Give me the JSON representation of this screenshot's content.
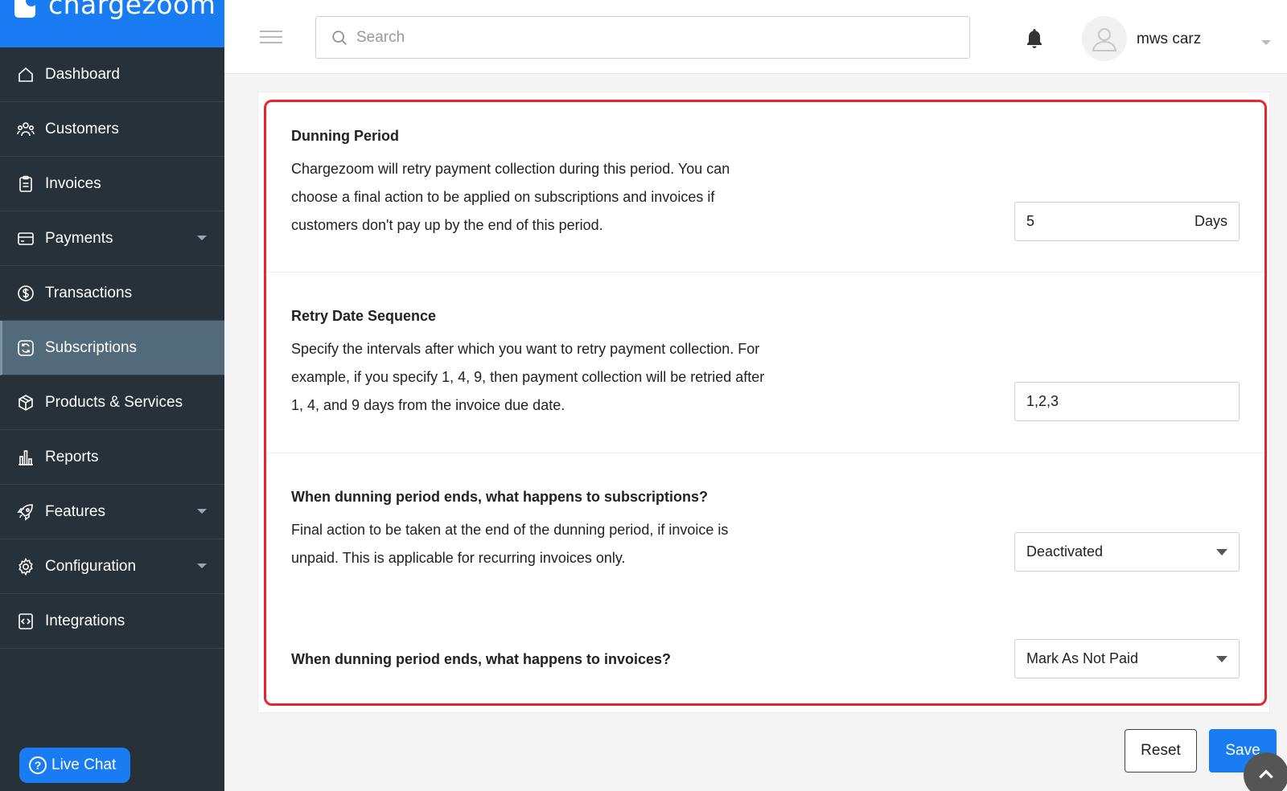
{
  "brand": {
    "name": "chargezoom"
  },
  "sidebar": {
    "items": [
      {
        "label": "Dashboard",
        "icon": "home-icon",
        "has_submenu": false,
        "active": false
      },
      {
        "label": "Customers",
        "icon": "users-icon",
        "has_submenu": false,
        "active": false
      },
      {
        "label": "Invoices",
        "icon": "clipboard-icon",
        "has_submenu": false,
        "active": false
      },
      {
        "label": "Payments",
        "icon": "card-icon",
        "has_submenu": true,
        "active": false
      },
      {
        "label": "Transactions",
        "icon": "dollar-icon",
        "has_submenu": false,
        "active": false
      },
      {
        "label": "Subscriptions",
        "icon": "refresh-icon",
        "has_submenu": false,
        "active": true
      },
      {
        "label": "Products & Services",
        "icon": "box-icon",
        "has_submenu": false,
        "active": false
      },
      {
        "label": "Reports",
        "icon": "bar-chart-icon",
        "has_submenu": false,
        "active": false
      },
      {
        "label": "Features",
        "icon": "rocket-icon",
        "has_submenu": true,
        "active": false
      },
      {
        "label": "Configuration",
        "icon": "gear-icon",
        "has_submenu": true,
        "active": false
      },
      {
        "label": "Integrations",
        "icon": "code-icon",
        "has_submenu": false,
        "active": false
      }
    ],
    "live_chat": "Live Chat"
  },
  "topbar": {
    "search_placeholder": "Search",
    "username": "mws carz"
  },
  "sections": {
    "dunning_period": {
      "title": "Dunning Period",
      "description": "Chargezoom will retry payment collection during this period. You can choose a final action to be applied on subscriptions and invoices if customers don't pay up by the end of this period.",
      "value": "5",
      "suffix": "Days"
    },
    "retry_sequence": {
      "title": "Retry Date Sequence",
      "description": "Specify the intervals after which you want to retry payment collection. For example, if you specify 1, 4, 9, then payment collection will be retried after 1, 4, and 9 days from the invoice due date.",
      "value": "1,2,3"
    },
    "subscriptions_action": {
      "title": "When dunning period ends, what happens to subscriptions?",
      "description": "Final action to be taken at the end of the dunning period, if invoice is unpaid. This is applicable for recurring invoices only.",
      "selected": "Deactivated"
    },
    "invoices_action": {
      "title": "When dunning period ends, what happens to invoices?",
      "selected": "Mark As Not Paid"
    }
  },
  "actions": {
    "reset": "Reset",
    "save": "Save"
  },
  "colors": {
    "accent": "#1a7cf2",
    "sidebar_bg": "#26313a",
    "sidebar_active": "#526a7a",
    "highlight_border": "#e8262a"
  }
}
